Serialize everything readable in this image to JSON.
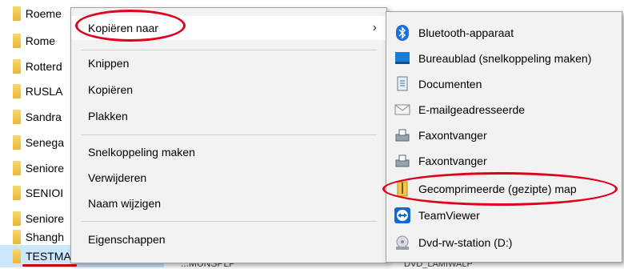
{
  "explorer": {
    "folders": [
      {
        "label": "Roeme"
      },
      {
        "label": "Rome"
      },
      {
        "label": "Rotterd"
      },
      {
        "label": "RUSLA"
      },
      {
        "label": "Sandra"
      },
      {
        "label": "Senega"
      },
      {
        "label": "Seniore"
      },
      {
        "label": "SENIOI"
      },
      {
        "label": "Seniore"
      },
      {
        "label": "Shangh"
      },
      {
        "label": "TESTMAP"
      }
    ],
    "fragment_left": "...MUNSPLP DOC",
    "fragment_right": "DVD_LAMIWALP"
  },
  "context_menu": {
    "items": [
      {
        "label": "Kopiëren naar"
      },
      {
        "label": "Knippen"
      },
      {
        "label": "Kopiëren"
      },
      {
        "label": "Plakken"
      },
      {
        "label": "Snelkoppeling maken"
      },
      {
        "label": "Verwijderen"
      },
      {
        "label": "Naam wijzigen"
      },
      {
        "label": "Eigenschappen"
      }
    ],
    "submenu_arrow": "›"
  },
  "submenu": {
    "items": [
      {
        "label": "Bluetooth-apparaat",
        "icon": "bluetooth-icon"
      },
      {
        "label": "Bureaublad (snelkoppeling maken)",
        "icon": "desktop-icon"
      },
      {
        "label": "Documenten",
        "icon": "documents-icon"
      },
      {
        "label": "E-mailgeadresseerde",
        "icon": "mail-recipient-icon"
      },
      {
        "label": "Faxontvanger",
        "icon": "fax-icon"
      },
      {
        "label": "Faxontvanger",
        "icon": "fax-icon"
      },
      {
        "label": "Gecomprimeerde (gezipte) map",
        "icon": "zip-folder-icon"
      },
      {
        "label": "TeamViewer",
        "icon": "teamviewer-icon"
      },
      {
        "label": "Dvd-rw-station (D:)",
        "icon": "dvd-drive-icon"
      }
    ]
  },
  "colors": {
    "selection": "#cce8ff",
    "annotation": "#e0001b",
    "menu_bg": "#f2f2f2"
  }
}
